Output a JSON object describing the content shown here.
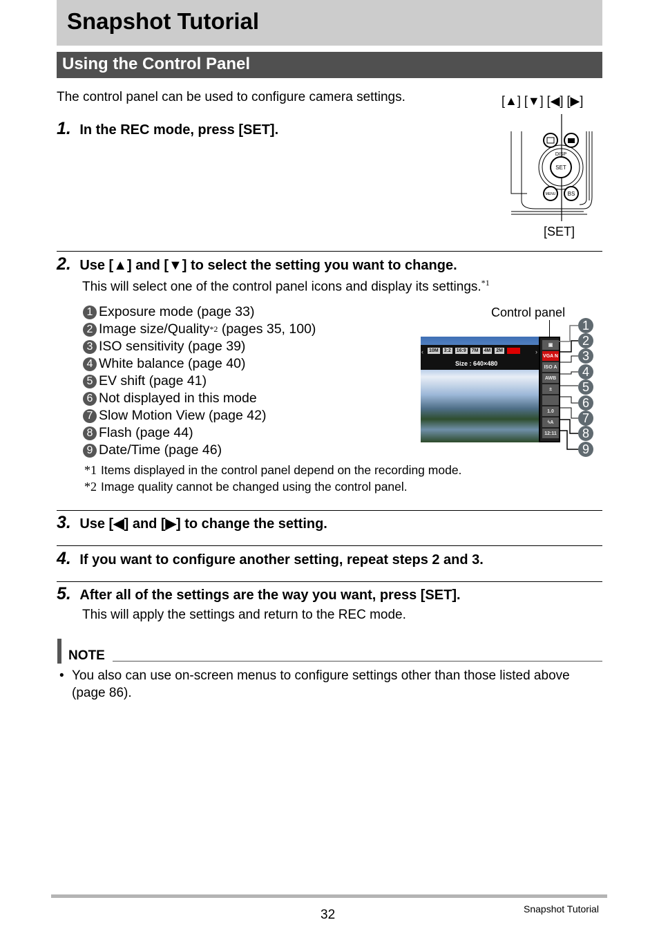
{
  "header": {
    "page_title": "Snapshot Tutorial",
    "section_title": "Using the Control Panel"
  },
  "intro": "The control panel can be used to configure camera settings.",
  "figure_buttons": {
    "arrows_label": "[▲] [▼] [◀] [▶]",
    "set_label": "[SET]",
    "disp_label": "DISP",
    "set_button": "SET",
    "menu_button": "MENU",
    "bs_button": "BS"
  },
  "steps": [
    {
      "number": "1.",
      "title": "In the REC mode, press [SET]."
    },
    {
      "number": "2.",
      "title": "Use [▲] and [▼] to select the setting you want to change.",
      "body": "This will select one of the control panel icons and display its settings.",
      "body_fn": "*1"
    },
    {
      "number": "3.",
      "title": "Use [◀] and [▶] to change the setting."
    },
    {
      "number": "4.",
      "title": "If you want to configure another setting, repeat steps 2 and 3."
    },
    {
      "number": "5.",
      "title": "After all of the settings are the way you want, press [SET].",
      "body": "This will apply the settings and return to the REC mode."
    }
  ],
  "panel_items": [
    {
      "n": "1",
      "label": "Exposure mode (page 33)"
    },
    {
      "n": "2",
      "label": "Image size/Quality",
      "fn": "*2",
      "suffix": " (pages 35, 100)"
    },
    {
      "n": "3",
      "label": "ISO sensitivity (page 39)"
    },
    {
      "n": "4",
      "label": "White balance (page 40)"
    },
    {
      "n": "5",
      "label": "EV shift (page 41)"
    },
    {
      "n": "6",
      "label": "Not displayed in this mode"
    },
    {
      "n": "7",
      "label": "Slow Motion View (page 42)"
    },
    {
      "n": "8",
      "label": "Flash (page 44)"
    },
    {
      "n": "9",
      "label": "Date/Time (page 46)"
    }
  ],
  "control_panel_figure": {
    "caption": "Control panel",
    "size_options": [
      "10M",
      "3:2",
      "16:9",
      "7M",
      "4M",
      "2M",
      "VGA"
    ],
    "selected_size": "VGA",
    "size_readout": "Size : 640×480",
    "strip_icons": [
      "▣",
      "VGA N",
      "ISO A",
      "AWB",
      "±",
      "",
      "1.0",
      "ϟA",
      "12:11"
    ],
    "numbers": [
      "1",
      "2",
      "3",
      "4",
      "5",
      "6",
      "7",
      "8",
      "9"
    ]
  },
  "footnotes": [
    {
      "mark": "*1",
      "text": "Items displayed in the control panel depend on the recording mode."
    },
    {
      "mark": "*2",
      "text": "Image quality cannot be changed using the control panel."
    }
  ],
  "note": {
    "label": "NOTE",
    "bullet": "•",
    "text": "You also can use on-screen menus to configure settings other than those listed above (page 86)."
  },
  "footer": {
    "page_number": "32",
    "section": "Snapshot Tutorial"
  }
}
